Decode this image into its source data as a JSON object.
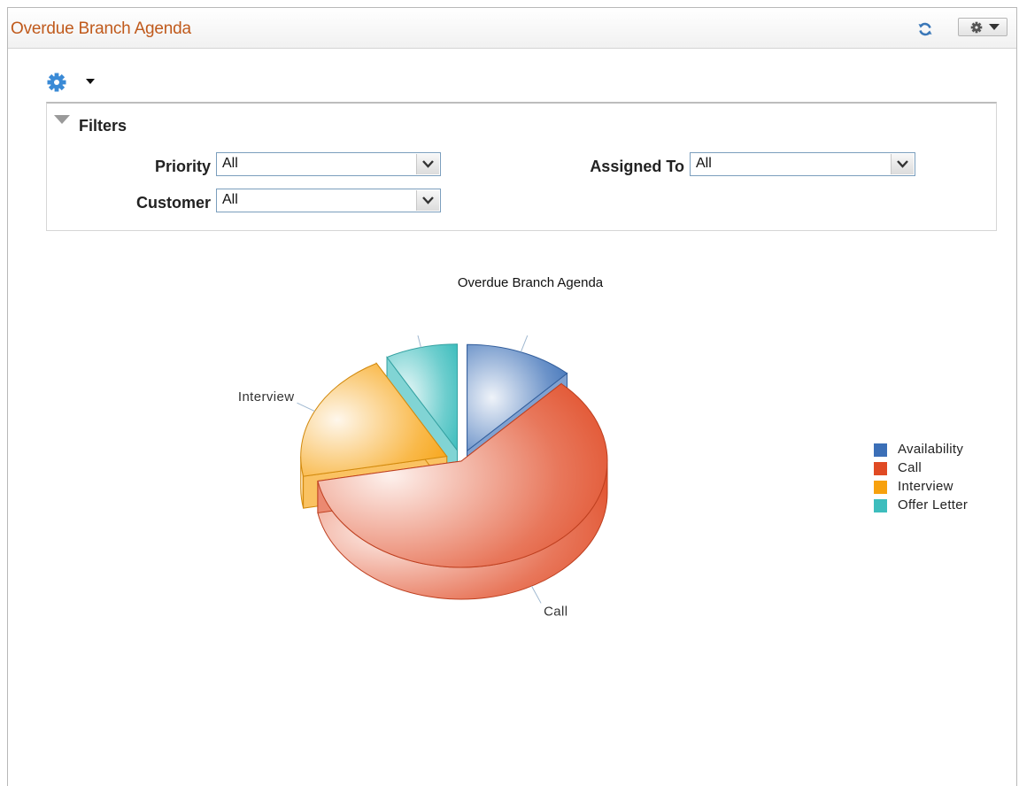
{
  "pagelet": {
    "title": "Overdue Branch Agenda",
    "refresh_icon": "refresh-icon",
    "options_icon": "gear-icon"
  },
  "toolbar": {
    "settings_icon": "gear-icon",
    "menu_icon": "caret-down-icon"
  },
  "filters": {
    "title": "Filters",
    "priority": {
      "label": "Priority",
      "value": "All"
    },
    "customer": {
      "label": "Customer",
      "value": "All"
    },
    "assigned_to": {
      "label": "Assigned To",
      "value": "All"
    }
  },
  "chart_data": {
    "type": "pie",
    "title": "Overdue Branch Agenda",
    "categories": [
      "Availability",
      "Call",
      "Interview",
      "Offer Letter"
    ],
    "values": [
      12,
      60,
      20,
      8
    ],
    "colors": [
      "#3b6fb7",
      "#e04a24",
      "#f7a10e",
      "#3dbdbd"
    ],
    "legend_position": "right",
    "exploded": [
      "Availability",
      "Interview",
      "Offer Letter"
    ]
  }
}
